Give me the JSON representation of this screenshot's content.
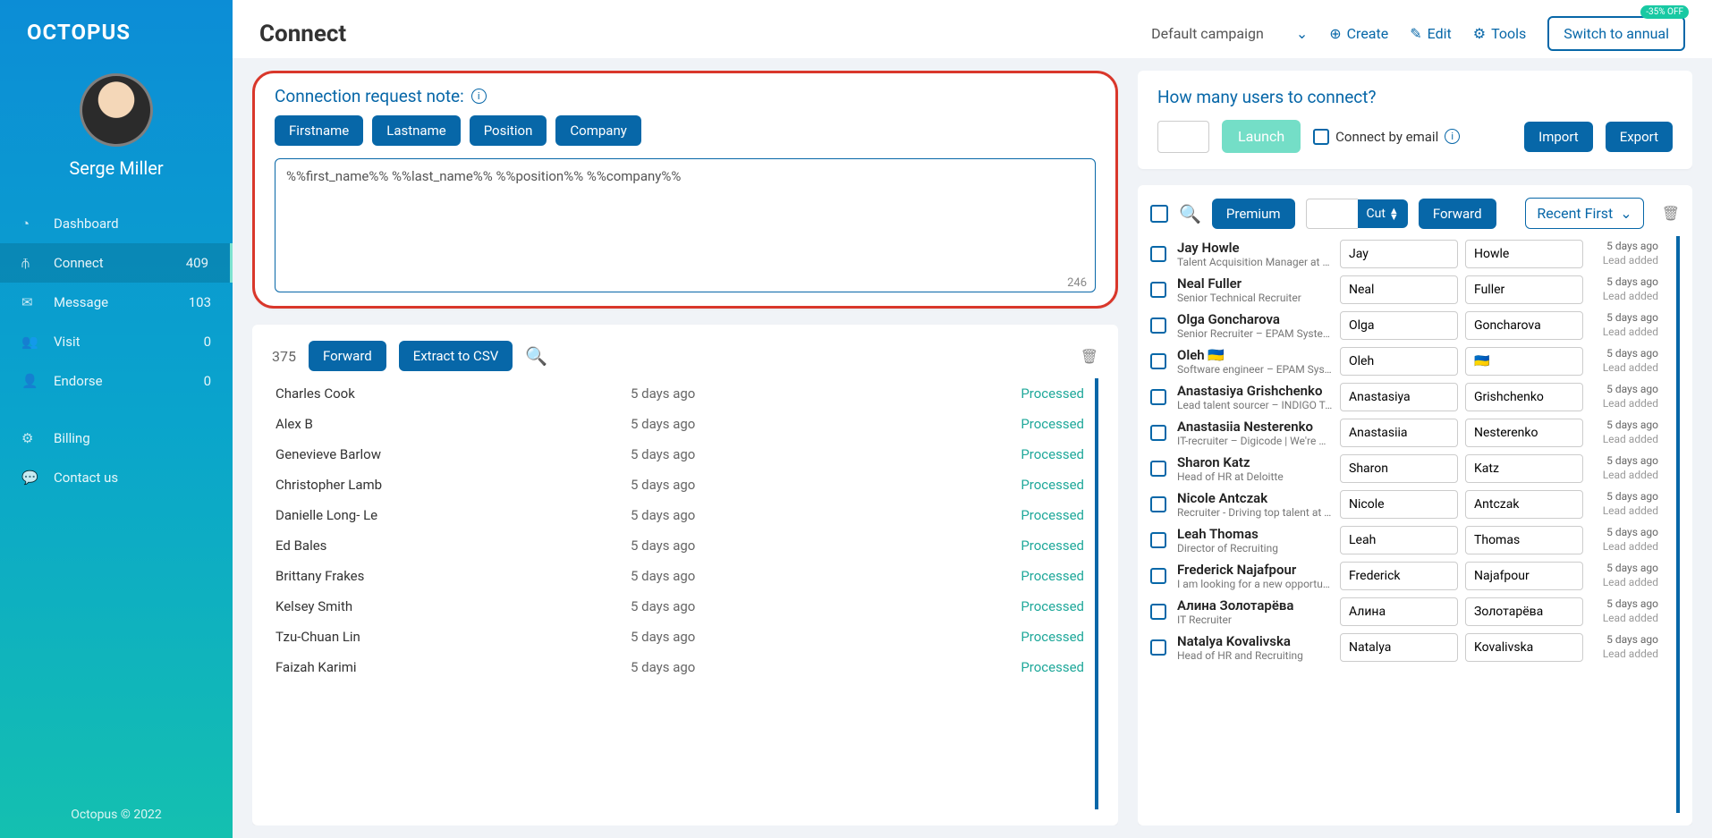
{
  "brand": "OCTOPUS",
  "profile": {
    "name": "Serge Miller"
  },
  "nav": [
    {
      "label": "Dashboard",
      "count": ""
    },
    {
      "label": "Connect",
      "count": "409",
      "active": true
    },
    {
      "label": "Message",
      "count": "103"
    },
    {
      "label": "Visit",
      "count": "0"
    },
    {
      "label": "Endorse",
      "count": "0"
    }
  ],
  "nav2": [
    {
      "label": "Billing"
    },
    {
      "label": "Contact us"
    }
  ],
  "footer": "Octopus © 2022",
  "page_title": "Connect",
  "toolbar": {
    "campaign": "Default campaign",
    "create": "Create",
    "edit": "Edit",
    "tools": "Tools",
    "switch": "Switch to annual",
    "discount": "-35% OFF"
  },
  "note": {
    "label": "Connection request note:",
    "tags": [
      "Firstname",
      "Lastname",
      "Position",
      "Company"
    ],
    "text": "%%first_name%% %%last_name%% %%position%% %%company%%",
    "remaining": "246"
  },
  "processed": {
    "count": "375",
    "forward": "Forward",
    "extract": "Extract to CSV",
    "rows": [
      {
        "name": "Charles Cook",
        "ago": "5 days ago",
        "status": "Processed"
      },
      {
        "name": "Alex B",
        "ago": "5 days ago",
        "status": "Processed"
      },
      {
        "name": "Genevieve Barlow",
        "ago": "5 days ago",
        "status": "Processed"
      },
      {
        "name": "Christopher Lamb",
        "ago": "5 days ago",
        "status": "Processed"
      },
      {
        "name": "Danielle Long- Le",
        "ago": "5 days ago",
        "status": "Processed"
      },
      {
        "name": "Ed Bales",
        "ago": "5 days ago",
        "status": "Processed"
      },
      {
        "name": "Brittany Frakes",
        "ago": "5 days ago",
        "status": "Processed"
      },
      {
        "name": "Kelsey Smith",
        "ago": "5 days ago",
        "status": "Processed"
      },
      {
        "name": "Tzu-Chuan Lin",
        "ago": "5 days ago",
        "status": "Processed"
      },
      {
        "name": "Faizah Karimi",
        "ago": "5 days ago",
        "status": "Processed"
      }
    ]
  },
  "connect": {
    "title": "How many users to connect?",
    "launch": "Launch",
    "by_email": "Connect by email",
    "import": "Import",
    "export": "Export"
  },
  "contacts": {
    "premium": "Premium",
    "cut": "Cut",
    "forward": "Forward",
    "recent": "Recent First",
    "rows": [
      {
        "name": "Jay Howle",
        "sub": "Talent Acquisition Manager at AE…",
        "fn": "Jay",
        "ln": "Howle",
        "ago": "5 days ago",
        "status": "Lead added"
      },
      {
        "name": "Neal Fuller",
        "sub": "Senior Technical Recruiter",
        "fn": "Neal",
        "ln": "Fuller",
        "ago": "5 days ago",
        "status": "Lead added"
      },
      {
        "name": "Olga Goncharova",
        "sub": "Senior Recruiter – EPAM Systems",
        "fn": "Olga",
        "ln": "Goncharova",
        "ago": "5 days ago",
        "status": "Lead added"
      },
      {
        "name": "Oleh 🇺🇦",
        "sub": "Software engineer – EPAM Syste…",
        "fn": "Oleh",
        "ln": "🇺🇦",
        "ago": "5 days ago",
        "status": "Lead added"
      },
      {
        "name": "Anastasiya Grishchenko",
        "sub": "Lead talent sourcer – INDIGO Tec…",
        "fn": "Anastasiya",
        "ln": "Grishchenko",
        "ago": "5 days ago",
        "status": "Lead added"
      },
      {
        "name": "Anastasiia Nesterenko",
        "sub": "IT-recruiter – Digicode | We're Ukr…",
        "fn": "Anastasiia",
        "ln": "Nesterenko",
        "ago": "5 days ago",
        "status": "Lead added"
      },
      {
        "name": "Sharon Katz",
        "sub": "Head of HR at Deloitte",
        "fn": "Sharon",
        "ln": "Katz",
        "ago": "5 days ago",
        "status": "Lead added"
      },
      {
        "name": "Nicole Antczak",
        "sub": "Recruiter - Driving top talent at Ri…",
        "fn": "Nicole",
        "ln": "Antczak",
        "ago": "5 days ago",
        "status": "Lead added"
      },
      {
        "name": "Leah Thomas",
        "sub": "Director of Recruiting",
        "fn": "Leah",
        "ln": "Thomas",
        "ago": "5 days ago",
        "status": "Lead added"
      },
      {
        "name": "Frederick Najafpour",
        "sub": "I am looking for a new opportunity.",
        "fn": "Frederick",
        "ln": "Najafpour",
        "ago": "5 days ago",
        "status": "Lead added"
      },
      {
        "name": "Алина Золотарёва",
        "sub": "IT Recruiter",
        "fn": "Алина",
        "ln": "Золотарёва",
        "ago": "5 days ago",
        "status": "Lead added"
      },
      {
        "name": "Natalya Kovalivska",
        "sub": "Head of HR and Recruiting",
        "fn": "Natalya",
        "ln": "Kovalivska",
        "ago": "5 days ago",
        "status": "Lead added"
      }
    ]
  }
}
